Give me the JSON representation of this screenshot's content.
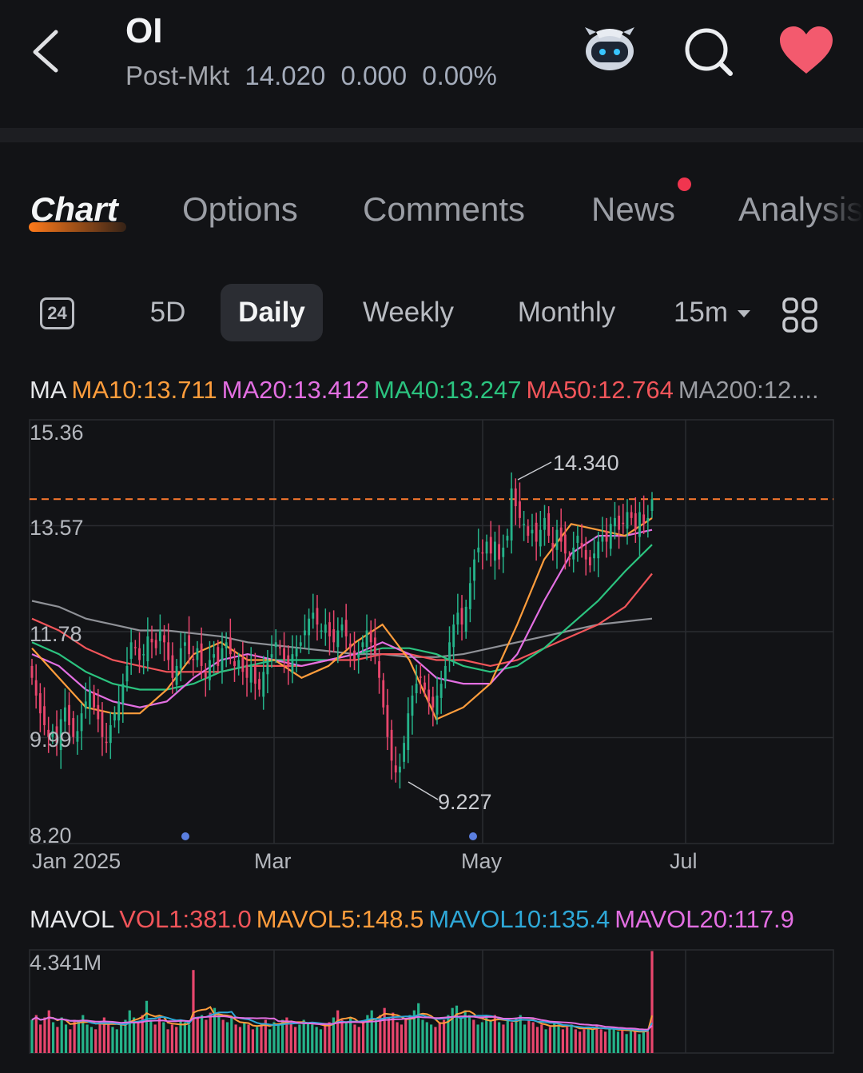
{
  "header": {
    "ticker": "OI",
    "session_label": "Post-Mkt",
    "price": "14.020",
    "change": "0.000",
    "change_pct": "0.00%"
  },
  "icons": {
    "back": "back-chevron-icon",
    "bot": "robot-assistant-icon",
    "search": "search-icon",
    "favorite": "heart-icon"
  },
  "tabs": [
    {
      "label": "Chart",
      "active": true
    },
    {
      "label": "Options"
    },
    {
      "label": "Comments"
    },
    {
      "label": "News",
      "badge": true
    },
    {
      "label": "Analysis"
    }
  ],
  "periods": {
    "day24": "24",
    "items": [
      "5D",
      "Daily",
      "Weekly",
      "Monthly"
    ],
    "active": "Daily",
    "interval": "15m"
  },
  "ma_legend": {
    "title": "MA",
    "items": [
      {
        "label": "MA10:13.711",
        "color": "#ff9d3c"
      },
      {
        "label": "MA20:13.412",
        "color": "#e36fe2"
      },
      {
        "label": "MA40:13.247",
        "color": "#2bc37f"
      },
      {
        "label": "MA50:12.764",
        "color": "#f2555a"
      },
      {
        "label": "MA200:12....",
        "color": "#9a9ca2"
      }
    ]
  },
  "vol_legend": {
    "title": "MAVOL",
    "items": [
      {
        "label": "VOL1:381.0",
        "color": "#f2555a"
      },
      {
        "label": "MAVOL5:148.5",
        "color": "#ff9d3c"
      },
      {
        "label": "MAVOL10:135.4",
        "color": "#2ea8d8"
      },
      {
        "label": "MAVOL20:117.9",
        "color": "#e36fe2"
      }
    ]
  },
  "chart_data": {
    "type": "candlestick",
    "y_ticks": [
      "15.36",
      "13.57",
      "11.78",
      "9.99",
      "8.20"
    ],
    "ylim": [
      8.2,
      15.36
    ],
    "x_ticks": [
      "Jan 2025",
      "Mar",
      "May",
      "Jul"
    ],
    "high_label": "14.340",
    "low_label": "9.227",
    "last_close": 14.02,
    "reference_line": 14.02,
    "colors": {
      "up": "#25b38a",
      "down": "#e8466d"
    },
    "closes": [
      11.0,
      10.7,
      10.4,
      10.2,
      10.0,
      10.1,
      9.9,
      10.3,
      10.5,
      10.2,
      10.0,
      10.1,
      10.4,
      10.6,
      10.8,
      10.5,
      10.3,
      10.0,
      9.9,
      10.2,
      10.4,
      10.6,
      10.9,
      11.2,
      11.6,
      11.5,
      11.3,
      11.4,
      11.7,
      11.6,
      11.5,
      11.8,
      11.6,
      11.3,
      11.0,
      11.2,
      11.5,
      11.6,
      11.4,
      11.3,
      11.5,
      11.2,
      11.0,
      11.3,
      11.4,
      11.2,
      11.5,
      11.6,
      11.4,
      11.2,
      11.3,
      11.1,
      11.0,
      11.2,
      10.9,
      10.8,
      11.1,
      11.3,
      11.4,
      11.6,
      11.5,
      11.3,
      11.2,
      11.4,
      11.5,
      11.6,
      11.8,
      12.0,
      12.1,
      11.9,
      11.8,
      11.9,
      11.7,
      11.6,
      11.8,
      11.9,
      11.7,
      11.5,
      11.3,
      11.4,
      11.6,
      11.8,
      11.6,
      11.4,
      11.0,
      10.5,
      10.0,
      9.6,
      9.4,
      9.5,
      9.9,
      10.4,
      10.7,
      10.9,
      11.0,
      10.8,
      10.6,
      10.5,
      10.7,
      10.9,
      11.2,
      11.6,
      11.9,
      12.1,
      11.9,
      12.2,
      12.6,
      13.0,
      13.2,
      13.1,
      13.3,
      13.1,
      13.3,
      13.0,
      13.2,
      13.4,
      14.2,
      13.9,
      13.7,
      13.6,
      13.4,
      13.5,
      13.3,
      13.5,
      13.7,
      13.4,
      13.2,
      13.5,
      13.3,
      13.1,
      13.0,
      13.2,
      13.4,
      13.2,
      13.0,
      12.9,
      13.1,
      13.3,
      13.4,
      13.3,
      13.6,
      13.7,
      13.5,
      13.6,
      13.8,
      13.7,
      13.5,
      13.8,
      13.6,
      13.7,
      14.02
    ],
    "ma_series": [
      {
        "name": "MA10",
        "points": [
          11.5,
          11.0,
          10.5,
          10.4,
          10.4,
          10.8,
          11.4,
          11.6,
          11.3,
          11.3,
          11.0,
          11.2,
          11.6,
          11.9,
          11.3,
          10.3,
          10.5,
          10.9,
          11.9,
          13.0,
          13.6,
          13.5,
          13.4,
          13.7
        ]
      },
      {
        "name": "MA20",
        "points": [
          11.4,
          11.2,
          10.8,
          10.6,
          10.5,
          10.6,
          11.0,
          11.3,
          11.4,
          11.3,
          11.2,
          11.3,
          11.4,
          11.6,
          11.4,
          11.0,
          10.9,
          10.9,
          11.4,
          12.3,
          13.1,
          13.4,
          13.4,
          13.5
        ]
      },
      {
        "name": "MA40",
        "points": [
          11.6,
          11.4,
          11.1,
          10.9,
          10.8,
          10.8,
          10.9,
          11.1,
          11.2,
          11.3,
          11.3,
          11.3,
          11.4,
          11.5,
          11.5,
          11.4,
          11.2,
          11.1,
          11.2,
          11.5,
          11.9,
          12.3,
          12.8,
          13.25
        ]
      },
      {
        "name": "MA50",
        "points": [
          12.0,
          11.8,
          11.5,
          11.3,
          11.2,
          11.1,
          11.1,
          11.1,
          11.2,
          11.2,
          11.2,
          11.3,
          11.3,
          11.4,
          11.4,
          11.3,
          11.3,
          11.2,
          11.3,
          11.5,
          11.7,
          11.9,
          12.2,
          12.76
        ]
      },
      {
        "name": "MA200",
        "points": [
          12.3,
          12.2,
          12.0,
          11.9,
          11.8,
          11.8,
          11.75,
          11.7,
          11.6,
          11.55,
          11.5,
          11.45,
          11.4,
          11.4,
          11.35,
          11.35,
          11.4,
          11.5,
          11.6,
          11.7,
          11.8,
          11.9,
          11.95,
          12.0
        ]
      }
    ],
    "volume": {
      "y_tick": "4.341M",
      "values": [
        1.4,
        1.6,
        1.2,
        1.5,
        1.8,
        1.3,
        1.1,
        1.5,
        1.2,
        1.0,
        1.4,
        1.3,
        1.6,
        1.2,
        1.1,
        1.0,
        1.3,
        1.5,
        1.2,
        1.1,
        1.0,
        1.2,
        1.4,
        1.8,
        1.5,
        1.3,
        1.6,
        2.2,
        1.4,
        1.2,
        1.5,
        1.3,
        1.0,
        1.2,
        1.1,
        1.4,
        1.3,
        1.2,
        3.5,
        1.5,
        1.6,
        1.4,
        1.7,
        1.9,
        1.6,
        1.4,
        1.3,
        1.5,
        1.2,
        1.1,
        1.3,
        1.2,
        1.0,
        1.1,
        1.2,
        1.4,
        1.0,
        1.3,
        1.2,
        1.4,
        1.5,
        1.3,
        1.1,
        1.2,
        1.4,
        1.3,
        1.2,
        1.1,
        1.0,
        1.2,
        1.3,
        1.5,
        1.8,
        1.4,
        1.3,
        1.5,
        1.2,
        1.1,
        1.3,
        1.6,
        1.8,
        1.4,
        1.6,
        1.9,
        1.5,
        1.7,
        1.3,
        1.2,
        1.4,
        1.6,
        1.8,
        2.1,
        1.4,
        1.3,
        1.2,
        1.1,
        1.3,
        1.4,
        1.6,
        1.9,
        2.0,
        1.5,
        1.8,
        1.6,
        1.4,
        1.2,
        1.3,
        1.5,
        1.4,
        1.6,
        1.3,
        1.2,
        1.4,
        1.3,
        1.5,
        1.6,
        1.2,
        1.4,
        1.3,
        1.1,
        1.2,
        1.0,
        1.1,
        1.3,
        1.2,
        1.0,
        1.1,
        1.2,
        1.0,
        0.9,
        1.0,
        1.1,
        1.0,
        1.2,
        1.0,
        0.9,
        1.0,
        1.1,
        0.9,
        1.0,
        0.8,
        1.0,
        0.9,
        0.8,
        1.0,
        0.9,
        4.3
      ]
    }
  }
}
